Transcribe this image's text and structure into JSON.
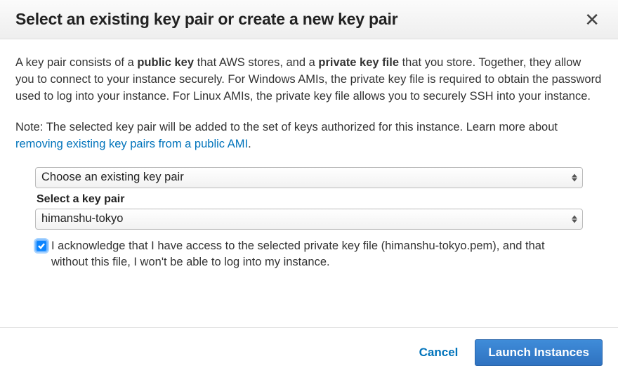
{
  "header": {
    "title": "Select an existing key pair or create a new key pair"
  },
  "body": {
    "p1_part1": "A key pair consists of a ",
    "p1_bold1": "public key",
    "p1_part2": " that AWS stores, and a ",
    "p1_bold2": "private key file",
    "p1_part3": " that you store. Together, they allow you to connect to your instance securely. For Windows AMIs, the private key file is required to obtain the password used to log into your instance. For Linux AMIs, the private key file allows you to securely SSH into your instance.",
    "p2_part1": "Note: The selected key pair will be added to the set of keys authorized for this instance. Learn more about ",
    "p2_link": " removing existing key pairs from a public AMI",
    "p2_part2": "."
  },
  "form": {
    "action_select_value": "Choose an existing key pair",
    "keypair_label": "Select a key pair",
    "keypair_select_value": "himanshu-tokyo",
    "ack_text": "I acknowledge that I have access to the selected private key file (himanshu-tokyo.pem), and that without this file, I won't be able to log into my instance."
  },
  "footer": {
    "cancel": "Cancel",
    "launch": "Launch Instances"
  }
}
